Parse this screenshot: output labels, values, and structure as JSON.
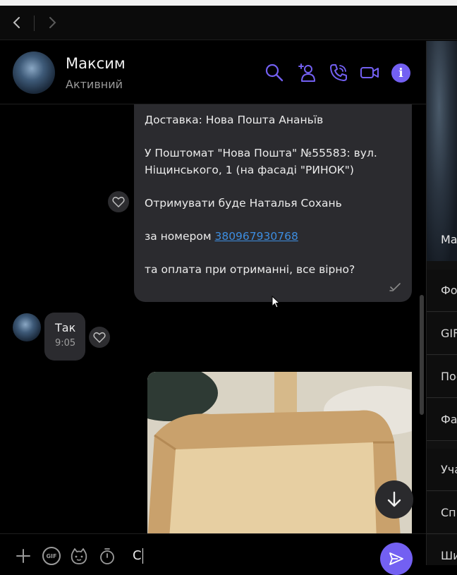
{
  "colors": {
    "accent": "#7360f2",
    "link": "#3d8de0",
    "bubble": "#2b2b2f"
  },
  "nav": {
    "back_icon": "chevron-left-icon",
    "forward_icon": "chevron-right-icon"
  },
  "header": {
    "name": "Максим",
    "status": "Активний",
    "icons": [
      "search-icon",
      "add-participant-icon",
      "voice-call-icon",
      "video-call-icon",
      "info-icon"
    ],
    "info_glyph": "i"
  },
  "messages": {
    "incoming_long": {
      "line1": "Доставка: Нова Пошта  Ананьїв",
      "line2": "У Поштомат \"Нова Пошта\" №55583: вул. Ніщинського, 1 (на фасаді \"РИНОК\")",
      "line3": "Отримувати буде Наталья Сохань",
      "line4_prefix": "за номером ",
      "line4_link": "380967930768",
      "line5": "та оплата при отриманні, все вірно?"
    },
    "short": {
      "text": "Так",
      "time": "9:05"
    }
  },
  "composer": {
    "value": "С",
    "icons": [
      "plus-icon",
      "gif-icon",
      "sticker-icon",
      "timer-icon",
      "send-icon"
    ],
    "gif_label": "GIF"
  },
  "sidebar": {
    "name_fragment": "Ма",
    "items": [
      "Фот",
      "GIF",
      "Пос",
      "Фай",
      "Уча",
      "Спі",
      "Ши"
    ]
  }
}
